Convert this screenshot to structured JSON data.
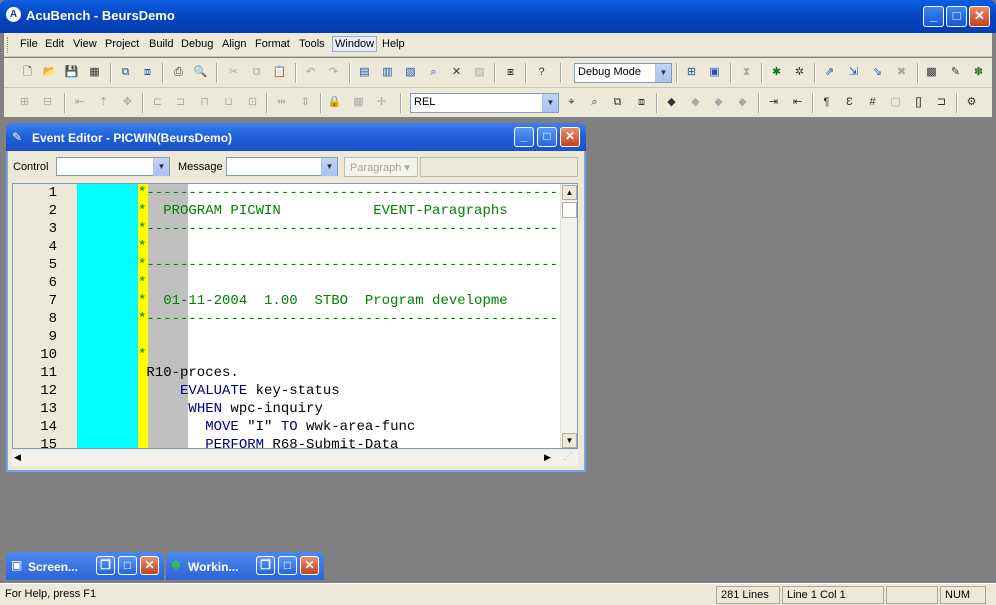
{
  "app": {
    "title": "AcuBench - BeursDemo",
    "icon": "A"
  },
  "menu": [
    "File",
    "Edit",
    "View",
    "Project",
    "Build",
    "Debug",
    "Align",
    "Format",
    "Tools",
    "Window",
    "Help"
  ],
  "toolbar": {
    "mode": "Debug Mode",
    "search_value": "REL"
  },
  "editor": {
    "title": "Event Editor - PICWIN(BeursDemo)",
    "control_label": "Control",
    "message_label": "Message",
    "paragraph_label": "Paragraph",
    "lines": [
      {
        "n": "1",
        "text": "*------------------------------------------------------",
        "color": "#008000"
      },
      {
        "n": "2",
        "text": "*  PROGRAM PICWIN           EVENT-Paragraphs",
        "color": "#008000"
      },
      {
        "n": "3",
        "text": "*------------------------------------------------------",
        "color": "#008000"
      },
      {
        "n": "4",
        "text": "*",
        "color": "#008000"
      },
      {
        "n": "5",
        "text": "*------------------------------------------------------",
        "color": "#008000"
      },
      {
        "n": "6",
        "text": "*",
        "color": "#008000"
      },
      {
        "n": "7",
        "text": "*  01-11-2004  1.00  STBO  Program developme",
        "color": "#008000"
      },
      {
        "n": "8",
        "text": "*------------------------------------------------------",
        "color": "#008000"
      },
      {
        "n": "9",
        "text": "",
        "color": "#000000"
      },
      {
        "n": "10",
        "text": "*",
        "color": "#008000"
      },
      {
        "n": "11",
        "text": " R10-proces.",
        "color": "#000000"
      },
      {
        "n": "12",
        "text": "     EVALUATE key-status",
        "color": "#000000"
      },
      {
        "n": "13",
        "text": "      WHEN wpc-inquiry",
        "color": "#000000"
      },
      {
        "n": "14",
        "text": "        MOVE \"I\" TO wwk-area-func",
        "color": "#000000"
      },
      {
        "n": "15",
        "text": "        PERFORM R68-Submit-Data",
        "color": "#000000"
      }
    ]
  },
  "minimized": [
    {
      "title": "Screen..."
    },
    {
      "title": "Workin..."
    }
  ],
  "status": {
    "help": "For Help, press F1",
    "lines": "281 Lines",
    "position": "Line 1 Col 1",
    "num": "NUM"
  },
  "colors": {
    "keyword": "#000080",
    "comment": "#008000",
    "gutter_cyan": "#00ffff",
    "gutter_yellow": "#ffff00"
  }
}
